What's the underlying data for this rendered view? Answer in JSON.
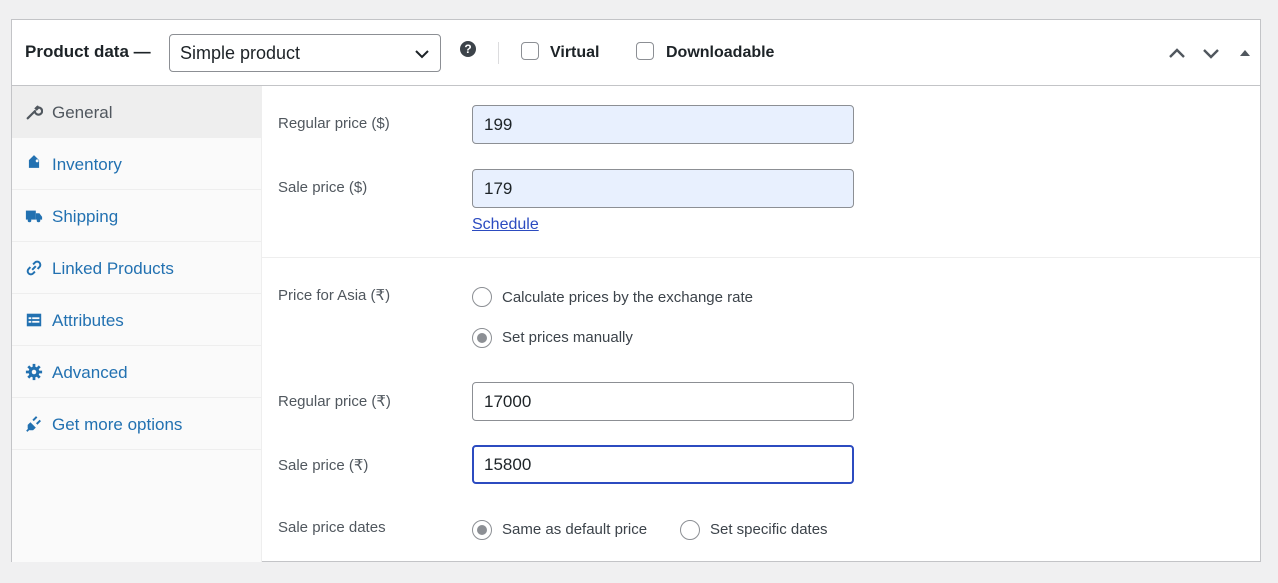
{
  "header": {
    "title": "Product data —",
    "product_type": "Simple product",
    "virtual_label": "Virtual",
    "downloadable_label": "Downloadable"
  },
  "sidebar": {
    "items": [
      {
        "label": "General",
        "icon": "wrench-icon",
        "active": true
      },
      {
        "label": "Inventory",
        "icon": "tag-icon"
      },
      {
        "label": "Shipping",
        "icon": "truck-icon"
      },
      {
        "label": "Linked Products",
        "icon": "link-icon"
      },
      {
        "label": "Attributes",
        "icon": "list-table-icon"
      },
      {
        "label": "Advanced",
        "icon": "gear-icon"
      },
      {
        "label": "Get more options",
        "icon": "plugin-icon"
      }
    ]
  },
  "general": {
    "regular_price_label": "Regular price ($)",
    "regular_price_value": "199",
    "sale_price_label": "Sale price ($)",
    "sale_price_value": "179",
    "schedule_link": "Schedule",
    "asia_label": "Price for Asia (₹)",
    "asia_option_exchange": "Calculate prices by the exchange rate",
    "asia_option_manual": "Set prices manually",
    "asia_regular_label": "Regular price (₹)",
    "asia_regular_value": "17000",
    "asia_sale_label": "Sale price (₹)",
    "asia_sale_value": "15800",
    "sale_dates_label": "Sale price dates",
    "sale_dates_default": "Same as default price",
    "sale_dates_specific": "Set specific dates"
  },
  "colors": {
    "link": "#2271b1",
    "focus": "#2c4bc0",
    "autofill": "#e8f0fe"
  }
}
